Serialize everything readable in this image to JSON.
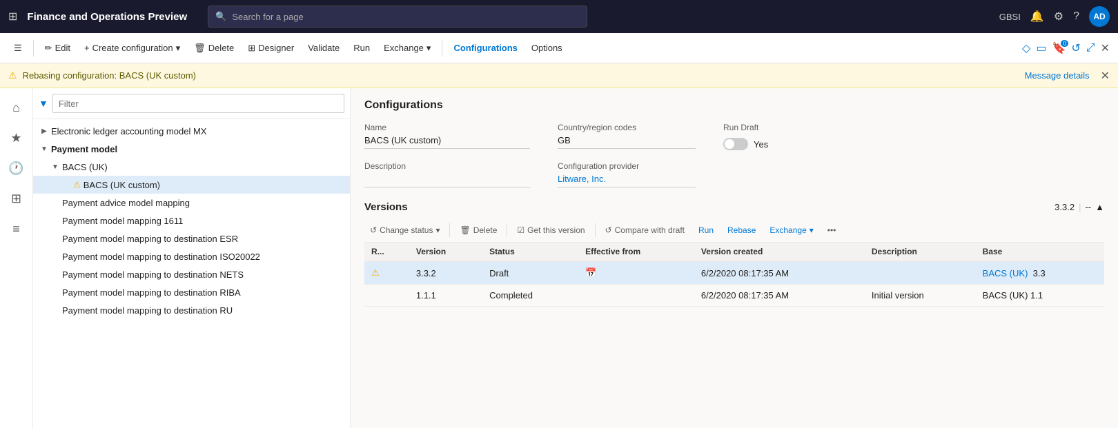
{
  "app": {
    "title": "Finance and Operations Preview",
    "search_placeholder": "Search for a page",
    "user_initials": "AD",
    "user_org": "GBSI"
  },
  "toolbar": {
    "edit_label": "Edit",
    "create_config_label": "Create configuration",
    "delete_label": "Delete",
    "designer_label": "Designer",
    "validate_label": "Validate",
    "run_label": "Run",
    "exchange_label": "Exchange",
    "configurations_label": "Configurations",
    "options_label": "Options"
  },
  "banner": {
    "message": "Rebasing configuration: BACS (UK custom)",
    "link": "Message details",
    "warning_icon": "⚠"
  },
  "filter": {
    "placeholder": "Filter"
  },
  "tree": {
    "items": [
      {
        "id": "1",
        "label": "Electronic ledger accounting model MX",
        "indent": 0,
        "has_arrow": true,
        "expanded": false,
        "bold": false,
        "warn": false
      },
      {
        "id": "2",
        "label": "Payment model",
        "indent": 0,
        "has_arrow": true,
        "expanded": true,
        "bold": true,
        "warn": false
      },
      {
        "id": "3",
        "label": "BACS (UK)",
        "indent": 1,
        "has_arrow": true,
        "expanded": true,
        "bold": false,
        "warn": false
      },
      {
        "id": "4",
        "label": "BACS (UK custom)",
        "indent": 2,
        "has_arrow": false,
        "expanded": false,
        "bold": false,
        "warn": true,
        "selected": true
      },
      {
        "id": "5",
        "label": "Payment advice model mapping",
        "indent": 1,
        "has_arrow": false,
        "expanded": false,
        "bold": false,
        "warn": false
      },
      {
        "id": "6",
        "label": "Payment model mapping 1611",
        "indent": 1,
        "has_arrow": false,
        "expanded": false,
        "bold": false,
        "warn": false
      },
      {
        "id": "7",
        "label": "Payment model mapping to destination ESR",
        "indent": 1,
        "has_arrow": false,
        "expanded": false,
        "bold": false,
        "warn": false
      },
      {
        "id": "8",
        "label": "Payment model mapping to destination ISO20022",
        "indent": 1,
        "has_arrow": false,
        "expanded": false,
        "bold": false,
        "warn": false
      },
      {
        "id": "9",
        "label": "Payment model mapping to destination NETS",
        "indent": 1,
        "has_arrow": false,
        "expanded": false,
        "bold": false,
        "warn": false
      },
      {
        "id": "10",
        "label": "Payment model mapping to destination RIBA",
        "indent": 1,
        "has_arrow": false,
        "expanded": false,
        "bold": false,
        "warn": false
      },
      {
        "id": "11",
        "label": "Payment model mapping to destination RU",
        "indent": 1,
        "has_arrow": false,
        "expanded": false,
        "bold": false,
        "warn": false
      }
    ]
  },
  "configurations": {
    "section_title": "Configurations",
    "name_label": "Name",
    "name_value": "BACS (UK custom)",
    "country_label": "Country/region codes",
    "country_value": "GB",
    "run_draft_label": "Run Draft",
    "run_draft_value": "Yes",
    "run_draft_on": false,
    "description_label": "Description",
    "description_value": "",
    "config_provider_label": "Configuration provider",
    "config_provider_value": "Litware, Inc."
  },
  "versions": {
    "title": "Versions",
    "version_display": "3.3.2",
    "dash": "--",
    "toolbar": {
      "change_status": "Change status",
      "delete": "Delete",
      "get_this_version": "Get this version",
      "compare_with_draft": "Compare with draft",
      "run": "Run",
      "rebase": "Rebase",
      "exchange": "Exchange"
    },
    "columns": [
      "R...",
      "Version",
      "Status",
      "Effective from",
      "Version created",
      "Description",
      "Base"
    ],
    "rows": [
      {
        "r": "⚠",
        "version": "3.3.2",
        "status": "Draft",
        "effective_from": "",
        "version_created": "6/2/2020 08:17:35 AM",
        "description": "",
        "base": "BACS (UK)",
        "base_version": "3.3",
        "selected": true,
        "warn": true,
        "base_is_link": true
      },
      {
        "r": "",
        "version": "1.1.1",
        "status": "Completed",
        "effective_from": "",
        "version_created": "6/2/2020 08:17:35 AM",
        "description": "Initial version",
        "base": "BACS (UK)",
        "base_version": "1.1",
        "selected": false,
        "warn": false,
        "base_is_link": false
      }
    ]
  }
}
